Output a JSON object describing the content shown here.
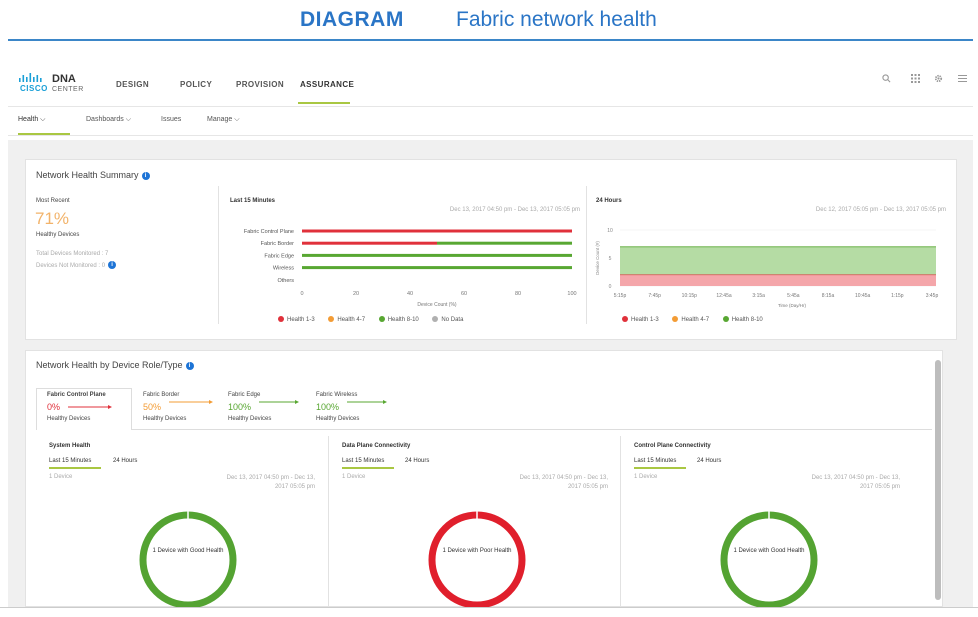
{
  "banner": {
    "tag": "DIAGRAM",
    "title": "Fabric network health"
  },
  "app": {
    "logo_mark": "CISCO",
    "brand": "DNA",
    "brand_sub": "CENTER"
  },
  "nav": {
    "tabs": [
      "DESIGN",
      "POLICY",
      "PROVISION",
      "ASSURANCE"
    ],
    "active": "ASSURANCE"
  },
  "topbar_icons": [
    "search-icon",
    "apps-grid-icon",
    "gear-icon",
    "menu-icon"
  ],
  "subnav": {
    "tabs": [
      "Health ⌵",
      "Dashboards ⌵",
      "Issues",
      "Manage ⌵"
    ],
    "active": "Health ⌵"
  },
  "summary": {
    "title": "Network Health Summary",
    "most_recent_label": "Most Recent",
    "health_pct": "71%",
    "health_label": "Healthy Devices",
    "monitored": "Total Devices Monitored : 7",
    "not_monitored": "Devices Not Monitored : 0",
    "accent_color": "#f2b36a"
  },
  "chart_15min": {
    "title": "Last 15 Minutes",
    "range": "Dec 13, 2017 04:50 pm - Dec 13, 2017 05:05 pm",
    "xlabel": "Device Count (%)",
    "ticks": [
      "0",
      "20",
      "40",
      "60",
      "80",
      "100"
    ]
  },
  "chart_24h": {
    "title": "24 Hours",
    "range": "Dec 12, 2017 05:05 pm - Dec 13, 2017 05:05 pm",
    "ylabel": "Device Count (#)",
    "yticks": [
      "0",
      "5",
      "10"
    ],
    "xticks": [
      "5:15p",
      "7:45p",
      "10:15p",
      "12:45a",
      "3:15a",
      "5:45a",
      "8:15a",
      "10:45a",
      "1:15p",
      "3:45p"
    ],
    "xlabel": "Time (Day/Hr)"
  },
  "chart_data": [
    {
      "type": "bar",
      "orientation": "horizontal",
      "stacked": true,
      "title": "Last 15 Minutes",
      "xlabel": "Device Count (%)",
      "xlim": [
        0,
        100
      ],
      "categories": [
        "Fabric Control Plane",
        "Fabric Border",
        "Fabric Edge",
        "Wireless",
        "Others"
      ],
      "series": [
        {
          "name": "Health 1-3",
          "color": "#e0313b",
          "values": [
            100,
            50,
            0,
            0,
            0
          ]
        },
        {
          "name": "Health 4-7",
          "color": "#f39c35",
          "values": [
            0,
            0,
            0,
            0,
            0
          ]
        },
        {
          "name": "Health 8-10",
          "color": "#58a732",
          "values": [
            0,
            50,
            100,
            100,
            0
          ]
        },
        {
          "name": "No Data",
          "color": "#b0b0b0",
          "values": [
            0,
            0,
            0,
            0,
            0
          ]
        }
      ],
      "legend": "bottom"
    },
    {
      "type": "area",
      "stacked": true,
      "title": "24 Hours",
      "xlabel": "Time (Day/Hr)",
      "ylabel": "Device Count (#)",
      "ylim": [
        0,
        10
      ],
      "x": [
        "5:15p",
        "7:45p",
        "10:15p",
        "12:45a",
        "3:15a",
        "5:45a",
        "8:15a",
        "10:45a",
        "1:15p",
        "3:45p"
      ],
      "series": [
        {
          "name": "Health 1-3",
          "color": "#f4a6aa",
          "values": [
            2,
            2,
            2,
            2,
            2,
            2,
            2,
            2,
            2,
            2
          ]
        },
        {
          "name": "Health 4-7",
          "color": "#f39c35",
          "values": [
            0,
            0,
            0,
            0,
            0,
            0,
            0,
            0,
            0,
            0
          ]
        },
        {
          "name": "Health 8-10",
          "color": "#b5dca4",
          "values": [
            5,
            5,
            5,
            5,
            5,
            5,
            5,
            5,
            5,
            5
          ]
        }
      ],
      "legend": "bottom"
    },
    {
      "type": "pie",
      "title": "System Health",
      "center_label": "1 Device with Good Health",
      "slices": [
        {
          "label": "Good Health",
          "value": 1,
          "color": "#54a332"
        }
      ]
    },
    {
      "type": "pie",
      "title": "Data Plane Connectivity",
      "center_label": "1 Device with Poor Health",
      "slices": [
        {
          "label": "Poor Health",
          "value": 1,
          "color": "#e01f2c"
        }
      ]
    },
    {
      "type": "pie",
      "title": "Control Plane Connectivity",
      "center_label": "1 Device with Good Health",
      "slices": [
        {
          "label": "Good Health",
          "value": 1,
          "color": "#54a332"
        }
      ]
    }
  ],
  "legend_items": [
    {
      "label": "Health 1-3",
      "color": "#e0313b"
    },
    {
      "label": "Health 4-7",
      "color": "#f39c35"
    },
    {
      "label": "Health 8-10",
      "color": "#58a732"
    },
    {
      "label": "No Data",
      "color": "#b0b0b0"
    }
  ],
  "legend_24h": [
    {
      "label": "Health 1-3",
      "color": "#e0313b"
    },
    {
      "label": "Health 4-7",
      "color": "#f39c35"
    },
    {
      "label": "Health 8-10",
      "color": "#58a732"
    }
  ],
  "role_section": {
    "title": "Network Health by Device Role/Type",
    "tabs": [
      {
        "name": "Fabric Control Plane",
        "pct": "0%",
        "label": "Healthy Devices",
        "color": "#e0313b"
      },
      {
        "name": "Fabric Border",
        "pct": "50%",
        "label": "Healthy Devices",
        "color": "#f39c35"
      },
      {
        "name": "Fabric Edge",
        "pct": "100%",
        "label": "Healthy Devices",
        "color": "#58a732"
      },
      {
        "name": "Fabric Wireless",
        "pct": "100%",
        "label": "Healthy Devices",
        "color": "#58a732"
      }
    ],
    "active_tab": "Fabric Control Plane"
  },
  "panels": [
    {
      "title": "System Health",
      "tab1": "Last 15 Minutes",
      "tab2": "24 Hours",
      "count": "1 Device",
      "range": "Dec 13, 2017 04:50 pm - Dec 13, 2017 05:05 pm",
      "center": "1 Device with Good Health"
    },
    {
      "title": "Data Plane Connectivity",
      "tab1": "Last 15 Minutes",
      "tab2": "24 Hours",
      "count": "1 Device",
      "range": "Dec 13, 2017 04:50 pm - Dec 13, 2017 05:05 pm",
      "center": "1 Device with Poor Health"
    },
    {
      "title": "Control Plane Connectivity",
      "tab1": "Last 15 Minutes",
      "tab2": "24 Hours",
      "count": "1 Device",
      "range": "Dec 13, 2017 04:50 pm - Dec 13, 2017 05:05 pm",
      "center": "1 Device with Good Health"
    }
  ]
}
